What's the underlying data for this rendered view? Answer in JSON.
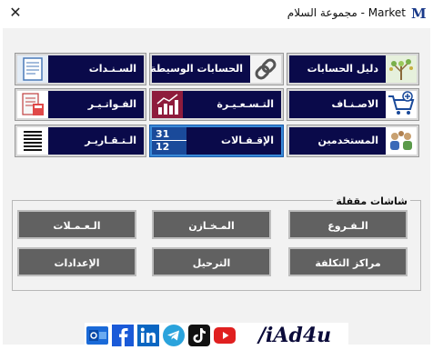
{
  "window": {
    "title": "Market - مجموعة السلام",
    "icon_letter": "M",
    "close_glyph": "✕"
  },
  "tiles": [
    {
      "label": "دليل الحسابات",
      "icon": "tree-icon"
    },
    {
      "label": "الحسابات الوسيطة",
      "icon": "chain-link-icon"
    },
    {
      "label": "السـنـدات",
      "icon": "document-icon"
    },
    {
      "label": "الاصـنـاف",
      "icon": "shopping-cart-icon"
    },
    {
      "label": "التـسـعـيـرة",
      "icon": "pricing-chart-icon"
    },
    {
      "label": "الفـواتـيـر",
      "icon": "invoice-icon"
    },
    {
      "label": "المستخدمين",
      "icon": "users-icon"
    },
    {
      "label": "الإقـفـالات",
      "icon": "calendar-icon"
    },
    {
      "label": "الـتـقـاريـر",
      "icon": "report-icon"
    }
  ],
  "calendar_icon": {
    "top": "31",
    "bottom": "12"
  },
  "locked_screens": {
    "title": "شاشات مقفلة",
    "buttons": [
      {
        "label": "الـفـروع"
      },
      {
        "label": "المـخـازن"
      },
      {
        "label": "الـعـمـلات"
      },
      {
        "label": "مراكز التكلفة"
      },
      {
        "label": "الترحيل"
      },
      {
        "label": "الإعدادات"
      }
    ]
  },
  "footer": {
    "brand": "/iAd4u",
    "icons": [
      "outlook-icon",
      "facebook-icon",
      "linkedin-icon",
      "telegram-icon",
      "tiktok-icon",
      "youtube-icon"
    ]
  },
  "colors": {
    "tile_bg": "#0a0a4a",
    "locked_button_bg": "#616161",
    "selected_border": "#3a8ad8"
  }
}
